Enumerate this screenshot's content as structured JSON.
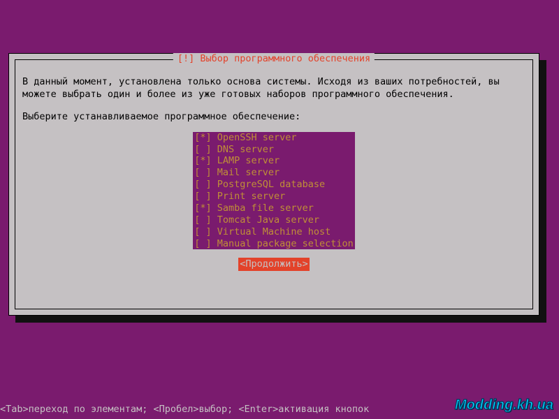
{
  "colors": {
    "background": "#7a1b6e",
    "panel": "#c5c1c3",
    "list_bg": "#7a1b6e",
    "list_fg": "#c08f37",
    "accent_red": "#e3422a"
  },
  "dialog": {
    "title": "[!] Выбор программного обеспечения",
    "intro": "В данный момент, установлена только основа системы. Исходя из ваших потребностей, вы можете выбрать один и более из уже готовых наборов программного обеспечения.",
    "prompt": "Выберите устанавливаемое программное обеспечение:",
    "options": [
      {
        "selected": true,
        "label": "OpenSSH server"
      },
      {
        "selected": false,
        "label": "DNS server"
      },
      {
        "selected": true,
        "label": "LAMP server"
      },
      {
        "selected": false,
        "label": "Mail server"
      },
      {
        "selected": false,
        "label": "PostgreSQL database"
      },
      {
        "selected": false,
        "label": "Print server"
      },
      {
        "selected": true,
        "label": "Samba file server"
      },
      {
        "selected": false,
        "label": "Tomcat Java server"
      },
      {
        "selected": false,
        "label": "Virtual Machine host"
      },
      {
        "selected": false,
        "label": "Manual package selection"
      }
    ],
    "continue": "<Продолжить>"
  },
  "helpbar": "<Tab>переход по элементам; <Пробел>выбор; <Enter>активация кнопок",
  "watermark": "Modding.kh.ua"
}
